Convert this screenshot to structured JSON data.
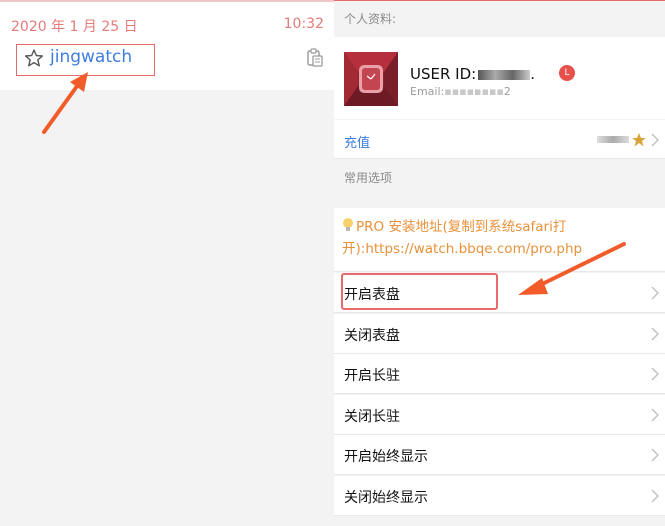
{
  "left": {
    "date": "2020 年 1 月 25 日",
    "time": "10:32",
    "note_title": "jingwatch"
  },
  "right": {
    "personal_header": "个人资料:",
    "profile": {
      "user_id_label": "USER ID:",
      "user_id_tail": ".",
      "email_label": "Email:",
      "email_tail": "2",
      "level": "L"
    },
    "recharge_label": "充值",
    "common_header": "常用选项",
    "pro_notice": "PRO 安装地址(复制到系统safari打开):https://watch.bbqe.com/pro.php",
    "menu": [
      {
        "label": "开启表盘"
      },
      {
        "label": "关闭表盘"
      },
      {
        "label": "开启长驻"
      },
      {
        "label": "关闭长驻"
      },
      {
        "label": "开启始终显示"
      },
      {
        "label": "关闭始终显示"
      }
    ]
  },
  "colors": {
    "accent_red": "#e86a6a",
    "link_blue": "#3d7de0",
    "notice_orange": "#e8913a",
    "arrow_orange": "#f25c2b"
  }
}
